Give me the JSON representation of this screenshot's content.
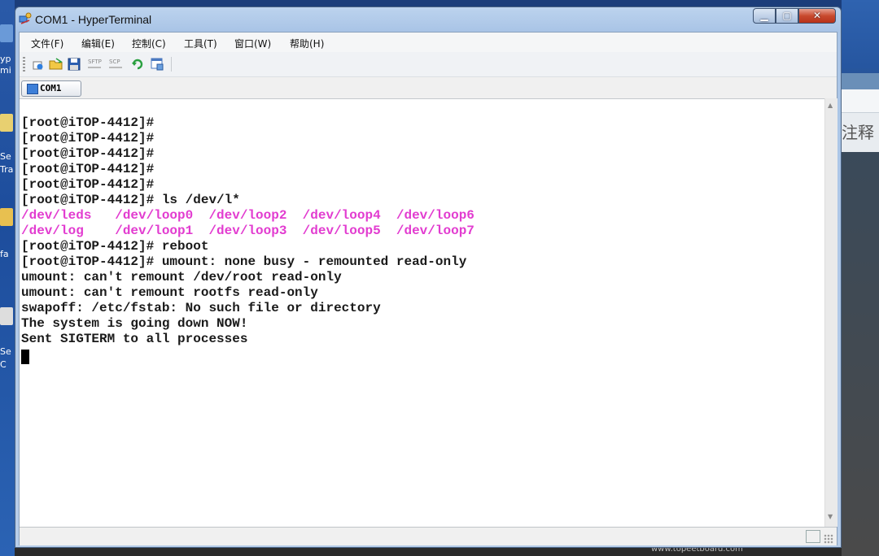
{
  "window": {
    "title": "COM1 - HyperTerminal",
    "minimize": "▁",
    "maximize": "▢",
    "close": "✕"
  },
  "menu": [
    "文件(F)",
    "编辑(E)",
    "控制(C)",
    "工具(T)",
    "窗口(W)",
    "帮助(H)"
  ],
  "toolbar": {
    "icons": [
      "new-connection-icon",
      "open-folder-icon",
      "save-icon",
      "sftp-icon",
      "scp-icon",
      "reconnect-icon",
      "properties-icon"
    ],
    "sftp_label": "SFTP",
    "scp_label": "SCP"
  },
  "tab": {
    "label": "COM1"
  },
  "terminal": {
    "lines": [
      {
        "text": "[root@iTOP-4412]#",
        "color": "default"
      },
      {
        "text": "[root@iTOP-4412]#",
        "color": "default"
      },
      {
        "text": "[root@iTOP-4412]#",
        "color": "default"
      },
      {
        "text": "[root@iTOP-4412]#",
        "color": "default"
      },
      {
        "text": "[root@iTOP-4412]#",
        "color": "default"
      },
      {
        "text": "[root@iTOP-4412]# ls /dev/l*",
        "color": "default"
      },
      {
        "text": "/dev/leds   /dev/loop0  /dev/loop2  /dev/loop4  /dev/loop6",
        "color": "magenta"
      },
      {
        "text": "/dev/log    /dev/loop1  /dev/loop3  /dev/loop5  /dev/loop7",
        "color": "magenta"
      },
      {
        "text": "[root@iTOP-4412]# reboot",
        "color": "default"
      },
      {
        "text": "[root@iTOP-4412]# umount: none busy - remounted read-only",
        "color": "default"
      },
      {
        "text": "umount: can't remount /dev/root read-only",
        "color": "default"
      },
      {
        "text": "umount: can't remount rootfs read-only",
        "color": "default"
      },
      {
        "text": "swapoff: /etc/fstab: No such file or directory",
        "color": "default"
      },
      {
        "text": "The system is going down NOW!",
        "color": "default"
      },
      {
        "text": "Sent SIGTERM to all processes",
        "color": "default"
      }
    ]
  },
  "desktop": {
    "left_labels": [
      "yp",
      "mi",
      "Se",
      "Tra",
      "fa",
      "Se",
      "C"
    ],
    "right_panel_text": "注释",
    "bottom_text": "www.topeetboard.com"
  },
  "colors": {
    "magenta": "#e23cd0",
    "terminal_bg": "#ffffff",
    "terminal_fg": "#1a1a1a"
  }
}
